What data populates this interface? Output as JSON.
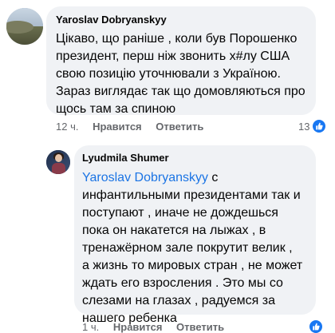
{
  "comments": [
    {
      "author": "Yaroslav Dobryanskyy",
      "lines": [
        "Цікаво, що раніше , коли був Порошенко",
        "президент, перш ніж звонить х#лу США",
        "свою позицію уточнювали з  Україною.",
        "Зараз виглядає так що домовляються про",
        "щось там за спиною"
      ],
      "time": "12 ч.",
      "like_action": "Нравится",
      "reply_action": "Ответить",
      "reaction_count": "13",
      "reaction_icon": "like-icon",
      "reaction_color": "#1877f2"
    },
    {
      "author": "Lyudmila Shumer",
      "mention": "Yaroslav Dobryanskyy",
      "first_line_rest": " с",
      "lines": [
        "инфантильными президентами так и",
        "поступают , иначе не дождешься",
        "пока он накатется на лыжах , в",
        "тренажёрном зале покрутит велик ,",
        "а жизнь то мировых стран  , не может",
        "ждать его  взросления . Это мы со",
        "слезами на глазах , радуемся за",
        "нашего ребенка"
      ],
      "time": "1 ч.",
      "like_action": "Нравится",
      "reply_action": "Ответить",
      "reaction_icon": "like-icon",
      "mention_color": "#1b74e4"
    }
  ],
  "colors": {
    "bubble_bg": "#f0f2f5",
    "meta_text": "#65676b",
    "text": "#050505"
  }
}
